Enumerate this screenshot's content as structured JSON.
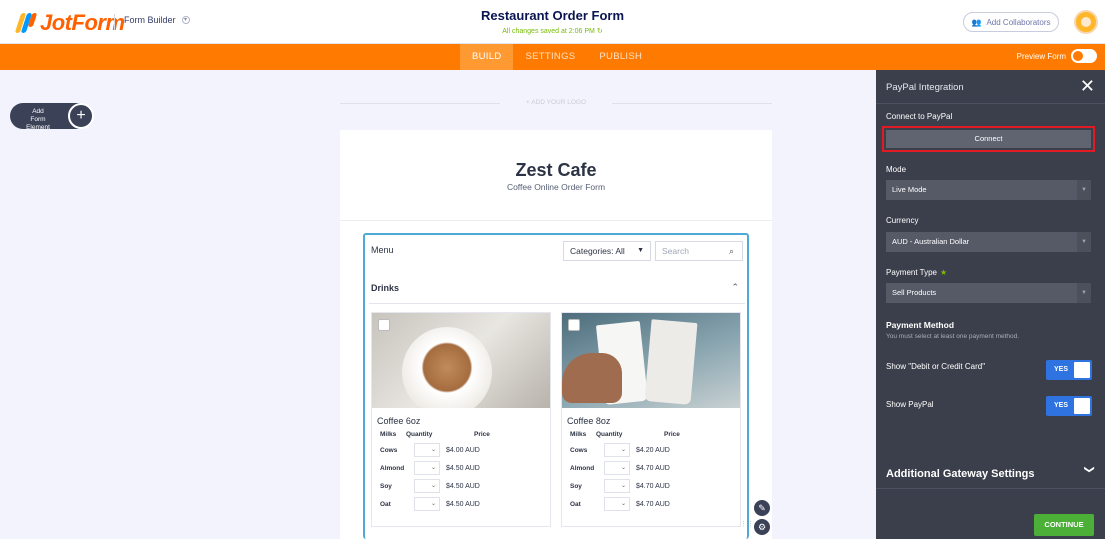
{
  "header": {
    "logo_text": "JotForm",
    "builder_label": "Form Builder",
    "form_title": "Restaurant Order Form",
    "save_status": "All changes saved at 2:06 PM",
    "collab_label": "Add Collaborators"
  },
  "nav": {
    "tabs": [
      {
        "label": "BUILD"
      },
      {
        "label": "SETTINGS"
      },
      {
        "label": "PUBLISH"
      }
    ],
    "preview_label": "Preview Form"
  },
  "builder": {
    "add_element_label": "Add Form Element",
    "add_logo_label": "+ ADD YOUR LOGO"
  },
  "form": {
    "title": "Zest Cafe",
    "subtitle": "Coffee Online Order Form",
    "menu_label": "Menu",
    "category_select": "Categories: All",
    "search_placeholder": "Search",
    "section_label": "Drinks",
    "columns": [
      "Milks",
      "Quantity",
      "Price"
    ],
    "products": [
      {
        "name": "Coffee 6oz",
        "rows": [
          {
            "milk": "Cows",
            "price": "$4.00 AUD"
          },
          {
            "milk": "Almond",
            "price": "$4.50 AUD"
          },
          {
            "milk": "Soy",
            "price": "$4.50 AUD"
          },
          {
            "milk": "Oat",
            "price": "$4.50 AUD"
          }
        ]
      },
      {
        "name": "Coffee 8oz",
        "rows": [
          {
            "milk": "Cows",
            "price": "$4.20 AUD"
          },
          {
            "milk": "Almond",
            "price": "$4.70 AUD"
          },
          {
            "milk": "Soy",
            "price": "$4.70 AUD"
          },
          {
            "milk": "Oat",
            "price": "$4.70 AUD"
          }
        ]
      }
    ]
  },
  "panel": {
    "title": "PayPal Integration",
    "connect_label": "Connect to PayPal",
    "connect_button": "Connect",
    "mode_label": "Mode",
    "mode_value": "Live Mode",
    "currency_label": "Currency",
    "currency_value": "AUD - Australian Dollar",
    "payment_type_label": "Payment Type",
    "payment_type_value": "Sell Products",
    "payment_method_title": "Payment Method",
    "payment_method_sub": "You must select at least one payment method.",
    "show_card_label": "Show \"Debit or Credit Card\"",
    "show_paypal_label": "Show PayPal",
    "yes_label": "YES",
    "additional_settings": "Additional Gateway Settings",
    "continue_button": "CONTINUE"
  },
  "colors": {
    "brand_orange": "#ff7a00",
    "accent_blue": "#2f73e0",
    "success_green": "#4caf38",
    "highlight_red": "#e01b24",
    "panel_bg": "#3b3f4b"
  },
  "icons": [
    "jotform-logo-icon",
    "chevron-down-icon",
    "collaborators-icon",
    "avatar-icon",
    "plus-icon",
    "search-icon",
    "chevron-up-icon",
    "close-icon",
    "wrench-icon",
    "gear-icon",
    "refresh-icon"
  ]
}
